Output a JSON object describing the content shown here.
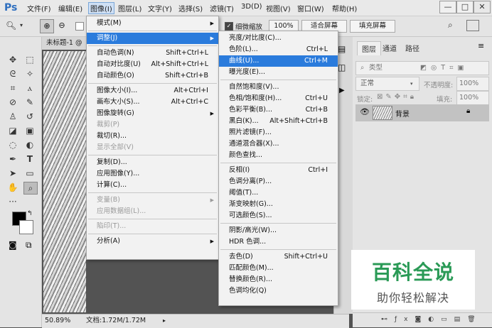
{
  "app": {
    "logo": "Ps",
    "title_tab": "未标题-1 @",
    "zoom": "50.89%",
    "doc_info": "文档:1.72M/1.72M"
  },
  "menubar": {
    "items": [
      "文件(F)",
      "编辑(E)",
      "图像(I)",
      "图层(L)",
      "文字(Y)",
      "选择(S)",
      "滤镜(T)",
      "3D(D)",
      "视图(V)",
      "窗口(W)",
      "帮助(H)"
    ],
    "active_index": 2,
    "win_controls": [
      "—",
      "□",
      "✕"
    ]
  },
  "options": {
    "checkbox_label": "细微缩放",
    "zoom_value": "100%",
    "fit_screen": "适合屏幕",
    "fill_screen": "填充屏幕"
  },
  "image_menu": [
    {
      "label": "模式(M)",
      "shortcut": "",
      "submenu": true
    },
    {
      "sep": true
    },
    {
      "label": "调整(J)",
      "shortcut": "",
      "submenu": true,
      "highlight": true
    },
    {
      "sep": true
    },
    {
      "label": "自动色调(N)",
      "shortcut": "Shift+Ctrl+L"
    },
    {
      "label": "自动对比度(U)",
      "shortcut": "Alt+Shift+Ctrl+L"
    },
    {
      "label": "自动颜色(O)",
      "shortcut": "Shift+Ctrl+B"
    },
    {
      "sep": true
    },
    {
      "label": "图像大小(I)...",
      "shortcut": "Alt+Ctrl+I"
    },
    {
      "label": "画布大小(S)...",
      "shortcut": "Alt+Ctrl+C"
    },
    {
      "label": "图像旋转(G)",
      "shortcut": "",
      "submenu": true
    },
    {
      "label": "裁剪(P)",
      "shortcut": "",
      "disabled": true
    },
    {
      "label": "裁切(R)...",
      "shortcut": ""
    },
    {
      "label": "显示全部(V)",
      "shortcut": "",
      "disabled": true
    },
    {
      "sep": true
    },
    {
      "label": "复制(D)...",
      "shortcut": ""
    },
    {
      "label": "应用图像(Y)...",
      "shortcut": ""
    },
    {
      "label": "计算(C)...",
      "shortcut": ""
    },
    {
      "sep": true
    },
    {
      "label": "变量(B)",
      "shortcut": "",
      "submenu": true,
      "disabled": true
    },
    {
      "label": "应用数据组(L)...",
      "shortcut": "",
      "disabled": true
    },
    {
      "sep": true
    },
    {
      "label": "陷印(T)...",
      "shortcut": "",
      "disabled": true
    },
    {
      "sep": true
    },
    {
      "label": "分析(A)",
      "shortcut": "",
      "submenu": true
    }
  ],
  "adjust_menu": [
    {
      "label": "亮度/对比度(C)...",
      "shortcut": ""
    },
    {
      "label": "色阶(L)...",
      "shortcut": "Ctrl+L"
    },
    {
      "label": "曲线(U)...",
      "shortcut": "Ctrl+M",
      "highlight": true
    },
    {
      "label": "曝光度(E)...",
      "shortcut": ""
    },
    {
      "sep": true
    },
    {
      "label": "自然饱和度(V)...",
      "shortcut": ""
    },
    {
      "label": "色相/饱和度(H)...",
      "shortcut": "Ctrl+U"
    },
    {
      "label": "色彩平衡(B)...",
      "shortcut": "Ctrl+B"
    },
    {
      "label": "黑白(K)...",
      "shortcut": "Alt+Shift+Ctrl+B"
    },
    {
      "label": "照片滤镜(F)...",
      "shortcut": ""
    },
    {
      "label": "通道混合器(X)...",
      "shortcut": ""
    },
    {
      "label": "颜色查找...",
      "shortcut": ""
    },
    {
      "sep": true
    },
    {
      "label": "反相(I)",
      "shortcut": "Ctrl+I"
    },
    {
      "label": "色调分离(P)...",
      "shortcut": ""
    },
    {
      "label": "阈值(T)...",
      "shortcut": ""
    },
    {
      "label": "渐变映射(G)...",
      "shortcut": ""
    },
    {
      "label": "可选颜色(S)...",
      "shortcut": ""
    },
    {
      "sep": true
    },
    {
      "label": "阴影/高光(W)...",
      "shortcut": ""
    },
    {
      "label": "HDR 色调...",
      "shortcut": ""
    },
    {
      "sep": true
    },
    {
      "label": "去色(D)",
      "shortcut": "Shift+Ctrl+U"
    },
    {
      "label": "匹配颜色(M)...",
      "shortcut": ""
    },
    {
      "label": "替换颜色(R)...",
      "shortcut": ""
    },
    {
      "label": "色调均化(Q)",
      "shortcut": ""
    }
  ],
  "layers_panel": {
    "tabs": [
      "图层",
      "通道",
      "路径"
    ],
    "kind_label": "类型",
    "blend_mode": "正常",
    "opacity_label": "不透明度:",
    "opacity_value": "100%",
    "lock_label": "锁定:",
    "fill_label": "填充:",
    "fill_value": "100%",
    "layer_name": "背景"
  },
  "watermark": {
    "title": "百科全说",
    "subtitle": "助你轻松解决"
  }
}
